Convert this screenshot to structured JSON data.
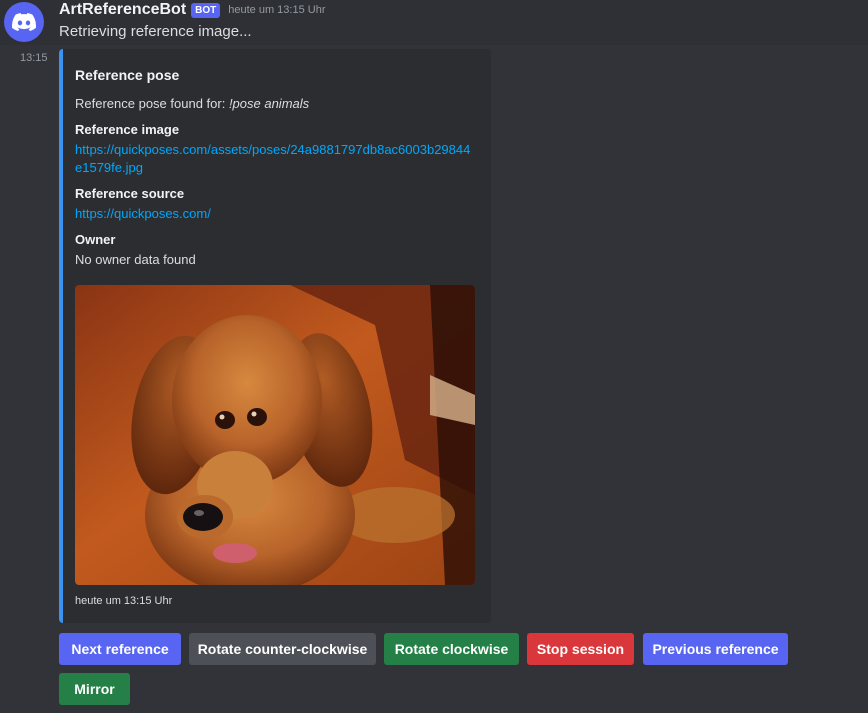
{
  "message": {
    "author": "ArtReferenceBot",
    "badge": "BOT",
    "timestamp": "heute um 13:15 Uhr",
    "text": "Retrieving reference image...",
    "side_time": "13:15"
  },
  "embed": {
    "accent_color": "#3b92f0",
    "title": "Reference pose",
    "description_prefix": "Reference pose found for: ",
    "description_command": "!pose animals",
    "fields": [
      {
        "name": "Reference image",
        "value": "https://quickposes.com/assets/poses/24a9881797db8ac6003b29844e1579fe.jpg"
      },
      {
        "name": "Reference source",
        "value": "https://quickposes.com/"
      },
      {
        "name": "Owner",
        "value": "No owner data found"
      }
    ],
    "image_subject": "golden-retriever-photo",
    "footer": "heute um 13:15 Uhr"
  },
  "buttons": [
    {
      "label": "Next reference",
      "style": "primary",
      "color": "#5865f2"
    },
    {
      "label": "Rotate counter-clockwise",
      "style": "secondary",
      "color": "#4e5058"
    },
    {
      "label": "Rotate clockwise",
      "style": "success",
      "color": "#248046"
    },
    {
      "label": "Stop session",
      "style": "danger",
      "color": "#da373c"
    },
    {
      "label": "Previous reference",
      "style": "primary",
      "color": "#5865f2"
    },
    {
      "label": "Mirror",
      "style": "success",
      "color": "#248046"
    }
  ]
}
